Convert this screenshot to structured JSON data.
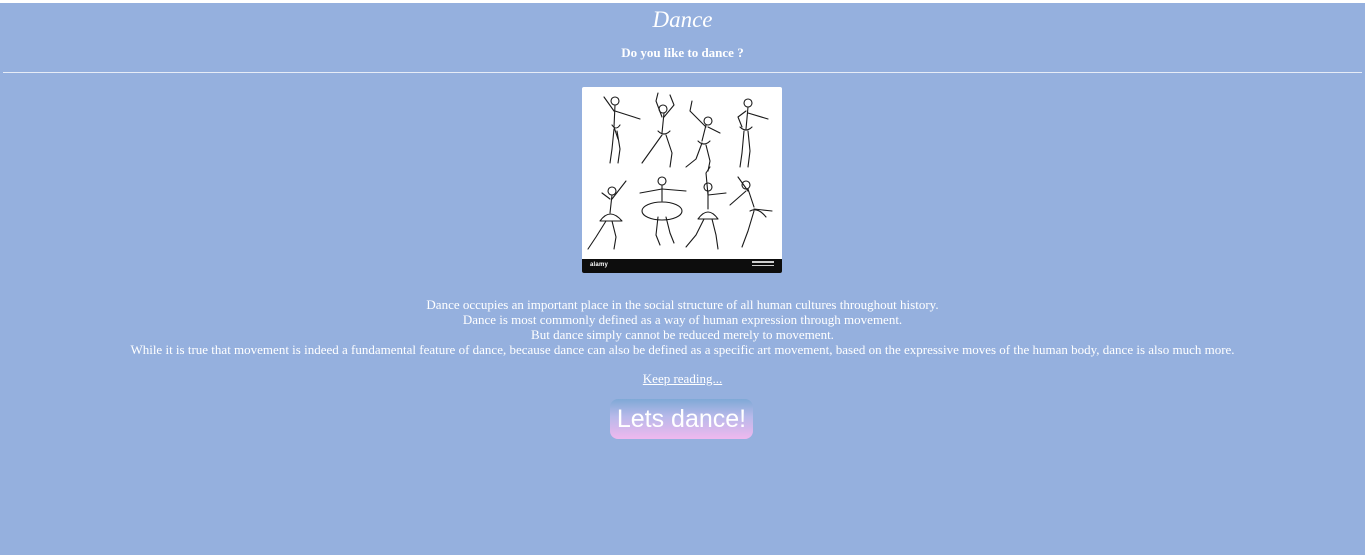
{
  "header": {
    "title": "Dance",
    "subtitle": "Do you like to dance ?"
  },
  "image": {
    "alt": "Ballerina line drawings",
    "watermark": "alamy"
  },
  "content": {
    "paragraph_lines": [
      "Dance occupies an important place in the social structure of all human cultures throughout history.",
      "Dance is most commonly defined as a way of human expression through movement.",
      "But dance simply cannot be reduced merely to movement.",
      "While it is true that movement is indeed a fundamental feature of dance, because dance can also be defined as a specific art movement, based on the expressive moves of the human body, dance is also much more."
    ],
    "keep_reading_label": "Keep reading..."
  },
  "actions": {
    "dance_button_label": "Lets dance!"
  },
  "colors": {
    "background": "#95b0de",
    "text": "#ffffff",
    "button_gradient_top": "#7fa9d6",
    "button_gradient_bottom": "#efb8ee"
  }
}
